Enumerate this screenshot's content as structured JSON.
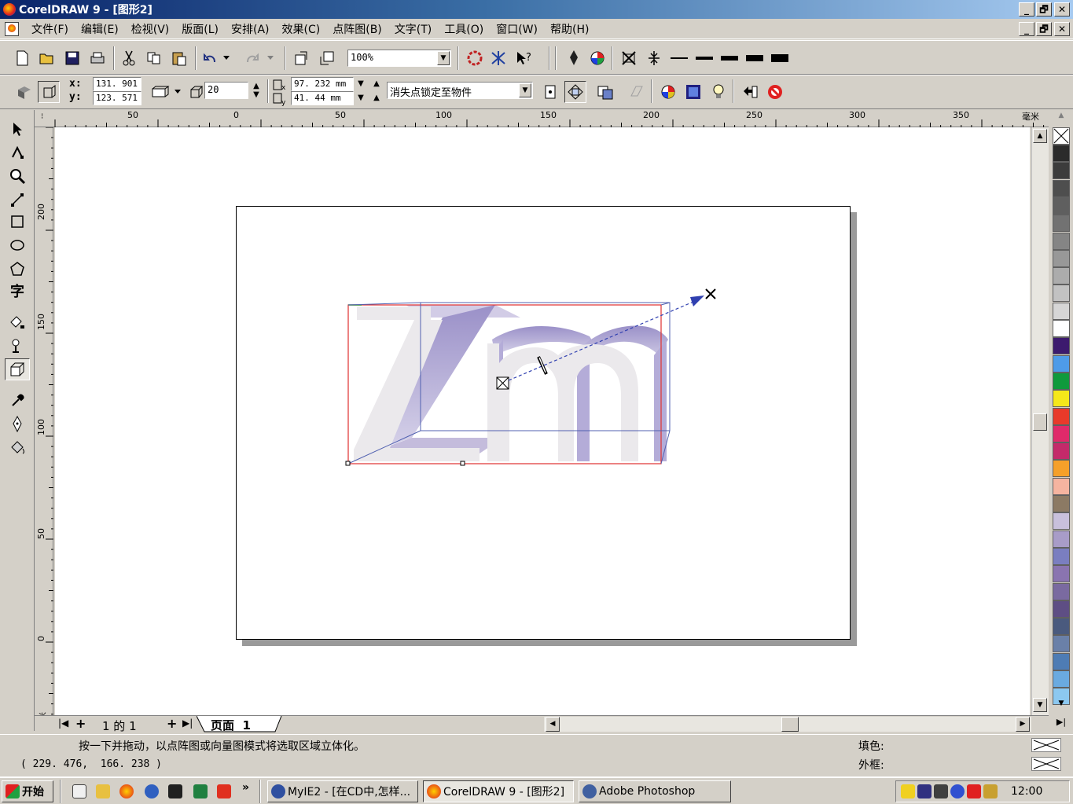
{
  "window": {
    "title": "CorelDRAW 9 - [图形2]",
    "minimize": "_",
    "restore": "🗗",
    "close": "✕"
  },
  "menu": [
    "文件(F)",
    "编辑(E)",
    "检视(V)",
    "版面(L)",
    "安排(A)",
    "效果(C)",
    "点阵图(B)",
    "文字(T)",
    "工具(O)",
    "窗口(W)",
    "帮助(H)"
  ],
  "standard_toolbar": {
    "zoom": "100%"
  },
  "property_bar": {
    "x_label": "x:",
    "y_label": "y:",
    "x_value": "131. 901",
    "y_value": "123. 571",
    "depth": "20",
    "vp_x": "97. 232  mm",
    "vp_y": "41. 44  mm",
    "vanishing_point_mode": "消失点锁定至物件"
  },
  "ruler": {
    "h_labels": [
      "50",
      "0",
      "50",
      "100",
      "150",
      "200",
      "250",
      "300",
      "350"
    ],
    "unit": "毫米",
    "v_labels": [
      "200",
      "150",
      "100",
      "50",
      "0"
    ],
    "v_unit": "毫米"
  },
  "artwork": {
    "text": "Zm"
  },
  "page_nav": {
    "first": "|◀",
    "add_before": "+",
    "counter": "1 的 1",
    "add_after": "+",
    "last": "▶|",
    "tab_label": "页面  1"
  },
  "status": {
    "hint": "按一下并拖动，以点阵图或向量图模式将选取区域立体化。",
    "coords": "( 229. 476,  166. 238 )",
    "fill_label": "填色:",
    "outline_label": "外框:"
  },
  "palette_colors": [
    "#2b2b2b",
    "#3c3c3c",
    "#4e4e4e",
    "#5f5f5f",
    "#727272",
    "#858585",
    "#989898",
    "#acacac",
    "#c2c2c2",
    "#d6d6d6",
    "#ffffff",
    "#3c1a6e",
    "#4e9be8",
    "#0f9a3c",
    "#f5e81a",
    "#e83a2a",
    "#e02a6a",
    "#c42a6a",
    "#f5a02a",
    "#f5b4a0",
    "#8c7a64",
    "#c8c0dc",
    "#a89cc8",
    "#7a7ec0",
    "#8a74b0",
    "#7a6aa0",
    "#5e4e84",
    "#4a5a7e",
    "#6a80a8",
    "#4e7cb4",
    "#6aaae0",
    "#8cc8f0"
  ],
  "taskbar": {
    "start": "开始",
    "more": "»",
    "tasks": [
      "MyIE2 - [在CD中,怎样...",
      "CorelDRAW 9 - [图形2]",
      "Adobe Photoshop"
    ],
    "clock": "12:00"
  }
}
